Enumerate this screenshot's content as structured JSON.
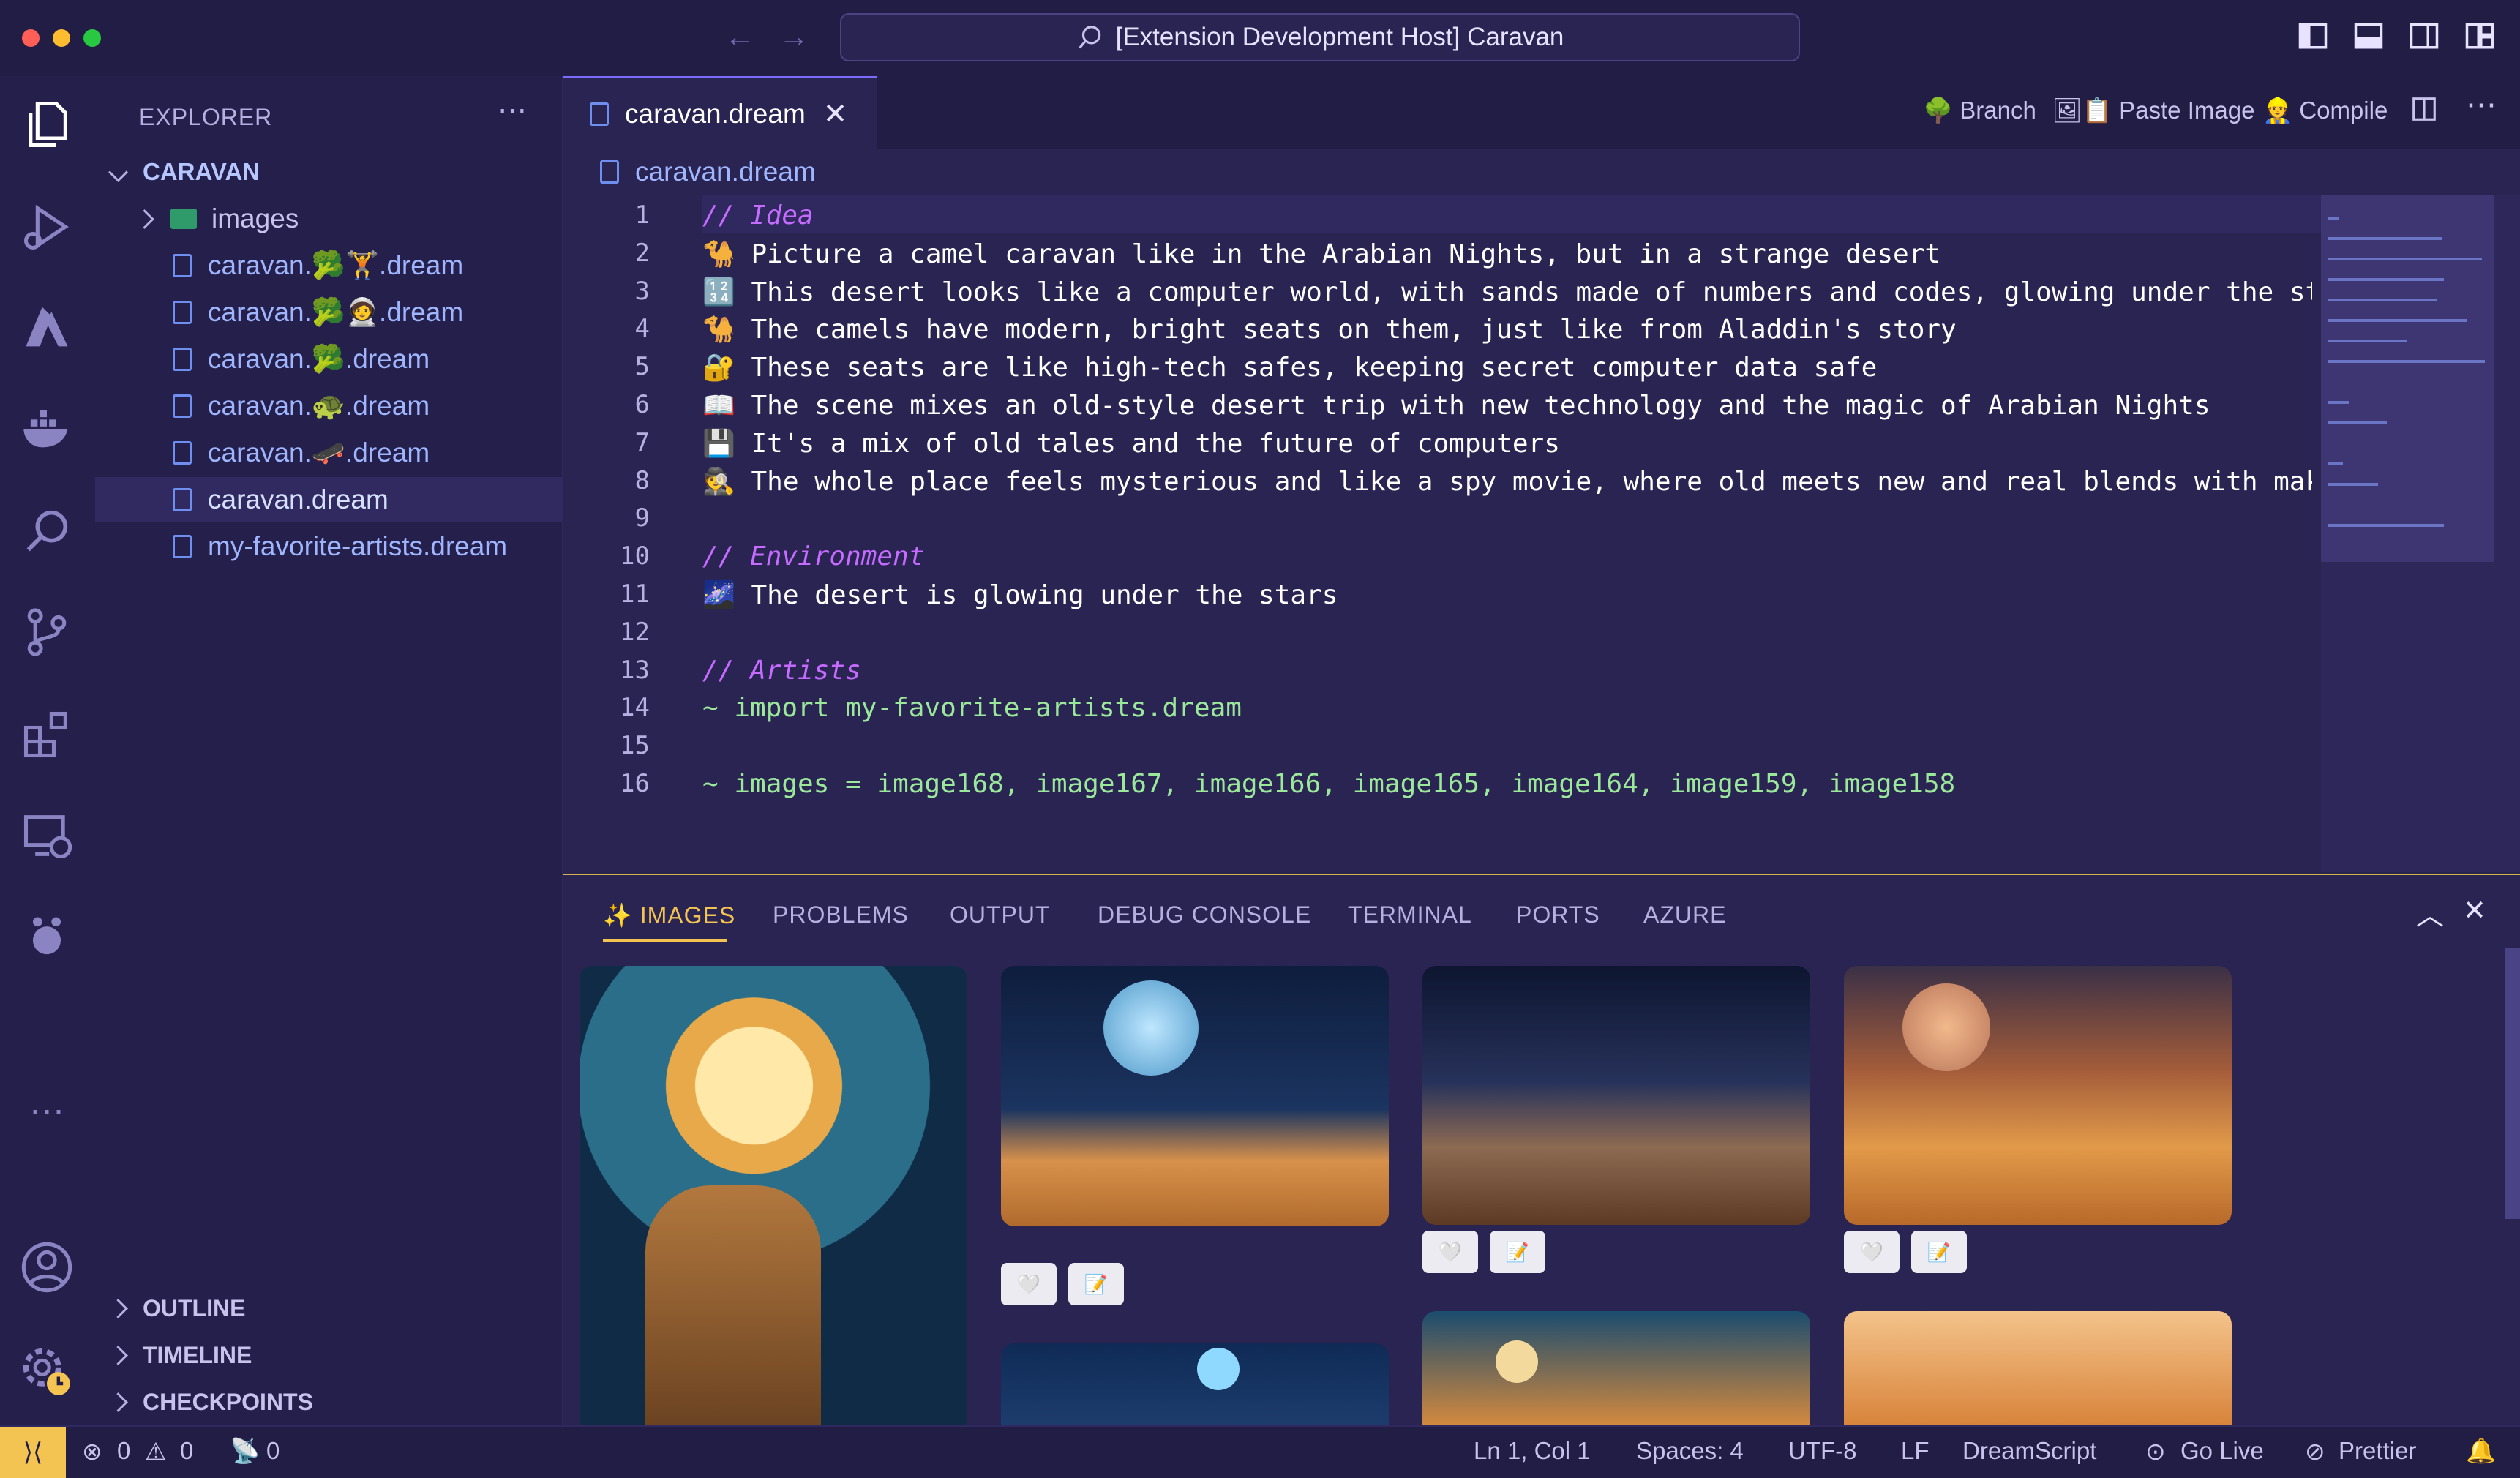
{
  "window": {
    "title": "[Extension Development Host] Caravan"
  },
  "explorer": {
    "header": "EXPLORER",
    "folder": "CARAVAN",
    "items": [
      {
        "label": "images",
        "type": "folder"
      },
      {
        "label": "caravan.🥦🏋.dream",
        "type": "file"
      },
      {
        "label": "caravan.🥦🧑‍🚀.dream",
        "type": "file"
      },
      {
        "label": "caravan.🥦.dream",
        "type": "file"
      },
      {
        "label": "caravan.🐢.dream",
        "type": "file"
      },
      {
        "label": "caravan.🛹.dream",
        "type": "file"
      },
      {
        "label": "caravan.dream",
        "type": "file",
        "selected": true
      },
      {
        "label": "my-favorite-artists.dream",
        "type": "file"
      }
    ],
    "sections": [
      "OUTLINE",
      "TIMELINE",
      "CHECKPOINTS"
    ]
  },
  "editor": {
    "tab_label": "caravan.dream",
    "breadcrumb": "caravan.dream",
    "actions": {
      "branch": "🌳 Branch",
      "paste": "🖼📋 Paste Image",
      "compile": "👷 Compile"
    },
    "lines": [
      {
        "n": "1",
        "text": "// Idea",
        "kind": "comment"
      },
      {
        "n": "2",
        "text": "🐪 Picture a camel caravan like in the Arabian Nights, but in a strange desert",
        "kind": "text"
      },
      {
        "n": "3",
        "text": "🔢 This desert looks like a computer world, with sands made of numbers and codes, glowing under the stars",
        "kind": "text"
      },
      {
        "n": "4",
        "text": "🐪 The camels have modern, bright seats on them, just like from Aladdin's story",
        "kind": "text"
      },
      {
        "n": "5",
        "text": "🔐 These seats are like high-tech safes, keeping secret computer data safe",
        "kind": "text"
      },
      {
        "n": "6",
        "text": "📖 The scene mixes an old-style desert trip with new technology and the magic of Arabian Nights",
        "kind": "text"
      },
      {
        "n": "7",
        "text": "💾 It's a mix of old tales and the future of computers",
        "kind": "text"
      },
      {
        "n": "8",
        "text": "🕵 The whole place feels mysterious and like a spy movie, where old meets new and real blends with make-bel",
        "kind": "text"
      },
      {
        "n": "9",
        "text": "",
        "kind": "text"
      },
      {
        "n": "10",
        "text": "// Environment",
        "kind": "comment"
      },
      {
        "n": "11",
        "text": "🌌 The desert is glowing under the stars",
        "kind": "text"
      },
      {
        "n": "12",
        "text": "",
        "kind": "text"
      },
      {
        "n": "13",
        "text": "// Artists",
        "kind": "comment"
      },
      {
        "n": "14",
        "text": "~ import my-favorite-artists.dream",
        "kind": "directive"
      },
      {
        "n": "15",
        "text": "",
        "kind": "text"
      },
      {
        "n": "16",
        "text": "~ images = image168, image167, image166, image165, image164, image159, image158",
        "kind": "directive"
      }
    ]
  },
  "panel": {
    "tabs": [
      "✨ IMAGES",
      "PROBLEMS",
      "OUTPUT",
      "DEBUG CONSOLE",
      "TERMINAL",
      "PORTS",
      "AZURE"
    ],
    "heart_icon": "🤍",
    "edit_icon": "📝"
  },
  "status": {
    "errors": "0",
    "warnings": "0",
    "ports": "0",
    "cursor": "Ln 1, Col 1",
    "spaces": "Spaces: 4",
    "encoding": "UTF-8",
    "eol": "LF",
    "language": "DreamScript",
    "golive": "Go Live",
    "prettier": "Prettier"
  },
  "colors": {
    "accent": "#f4c453",
    "background": "#2a2453",
    "comment": "#c56bff",
    "directive": "#9be89b"
  }
}
